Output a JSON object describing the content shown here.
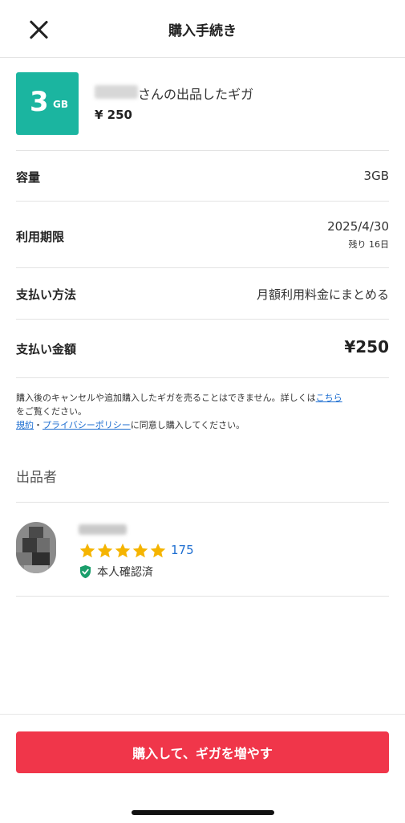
{
  "header": {
    "title": "購入手続き"
  },
  "product": {
    "tile_number": "3",
    "tile_unit": "GB",
    "title": "さんの出品したギガ",
    "price": "¥ 250"
  },
  "details": {
    "capacity_label": "容量",
    "capacity_value": "3GB",
    "expiry_label": "利用期限",
    "expiry_value": "2025/4/30",
    "expiry_remaining": "残り 16日",
    "payment_label": "支払い方法",
    "payment_value": "月額利用料金にまとめる",
    "amount_label": "支払い金額",
    "amount_value": "¥250"
  },
  "notice": {
    "line1": "購入後のキャンセルや追加購入したギガを売ることはできません。詳しくは",
    "link_here": "こちら",
    "line2": "をご覧ください。",
    "link_terms": "規約",
    "dot": "・",
    "link_privacy": "プライバシーポリシー",
    "line3": "に同意し購入してください。"
  },
  "seller": {
    "section_title": "出品者",
    "rating_count": "175",
    "stars": 5,
    "verified_label": "本人確認済"
  },
  "colors": {
    "accent": "#f0364a",
    "tile": "#1bb5a0",
    "star": "#f5b400",
    "link": "#1f6fd1",
    "verified": "#1a9e6b"
  },
  "buy_button": {
    "label": "購入して、ギガを増やす"
  }
}
